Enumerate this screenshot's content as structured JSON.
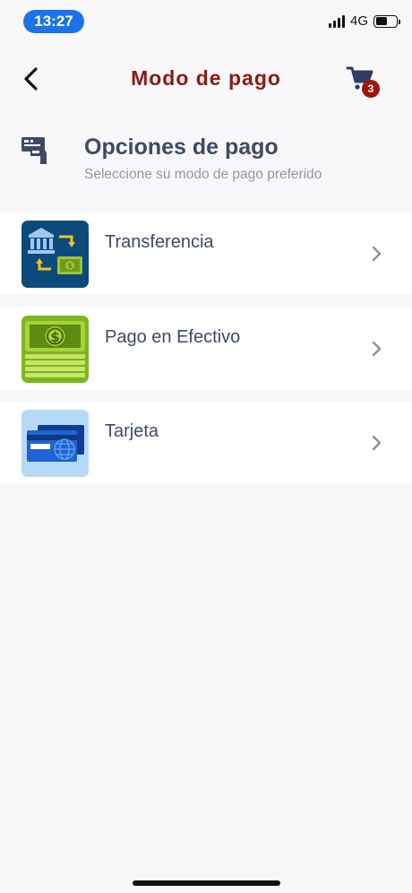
{
  "status_bar": {
    "time": "13:27",
    "network": "4G"
  },
  "header": {
    "title": "Modo de pago",
    "cart_count": "3",
    "accent_color": "#8e1a12"
  },
  "section": {
    "title": "Opciones de pago",
    "subtitle": "Seleccione su modo de pago preferido",
    "icon": "payment-terminal-icon"
  },
  "options": [
    {
      "label": "Transferencia",
      "icon": "bank-transfer-icon"
    },
    {
      "label": "Pago en Efectivo",
      "icon": "cash-icon"
    },
    {
      "label": "Tarjeta",
      "icon": "credit-card-icon"
    }
  ]
}
